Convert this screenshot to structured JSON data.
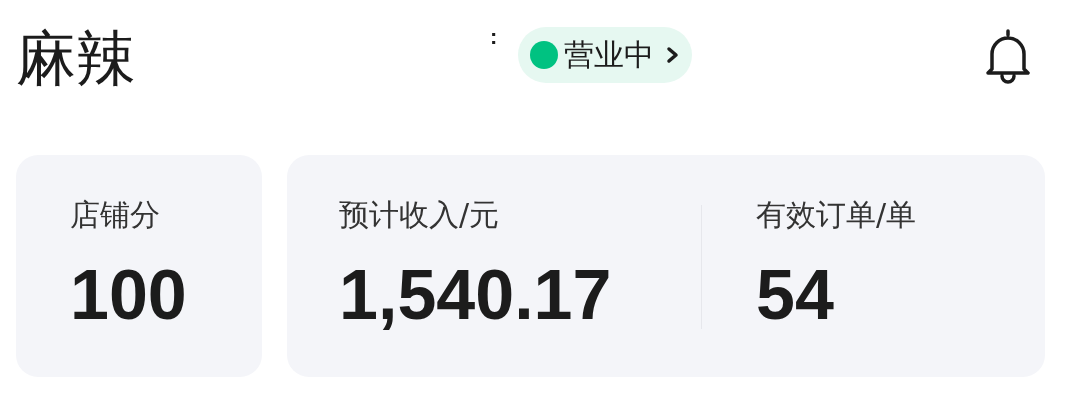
{
  "header": {
    "title": "麻辣",
    "mark": ":",
    "status": {
      "label": "营业中",
      "open": true
    }
  },
  "cards": [
    {
      "stats": [
        {
          "label": "店铺分",
          "value": "100"
        }
      ]
    },
    {
      "stats": [
        {
          "label": "预计收入/元",
          "value": "1,540.17"
        },
        {
          "label": "有效订单/单",
          "value": "54"
        }
      ]
    }
  ]
}
